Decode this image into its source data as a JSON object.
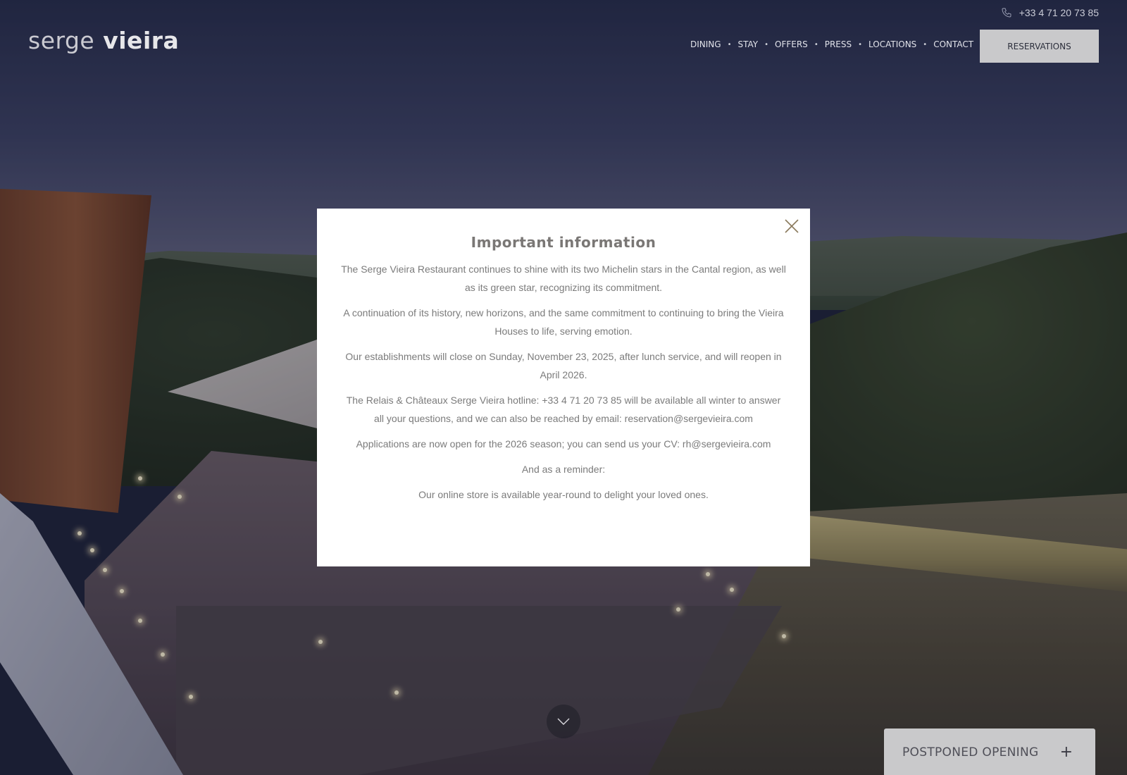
{
  "header": {
    "phone": "+33 4 71 20 73 85",
    "logo": {
      "light": "serge",
      "bold": "vieira"
    },
    "nav": [
      "DINING",
      "STAY",
      "OFFERS",
      "PRESS",
      "LOCATIONS",
      "CONTACT"
    ],
    "nav_separator": "•",
    "reservations_label": "RESERVATIONS"
  },
  "modal": {
    "title": "Important information",
    "paragraphs": [
      "The Serge Vieira Restaurant continues to shine with its two Michelin stars in the Cantal region, as well as its green star, recognizing its commitment.",
      "A continuation of its history, new horizons, and the same commitment to continuing to bring the Vieira Houses to life, serving emotion.",
      "Our establishments will close on Sunday, November 23, 2025, after lunch service, and will reopen in April 2026.",
      "The Relais & Châteaux Serge Vieira hotline: +33 4 71 20 73 85 will be available all winter to answer all your questions, and we can also be reached by email: reservation@sergevieira.com",
      "Applications are now open for the 2026 season; you can send us your CV: rh@sergevieira.com",
      "And as a reminder:",
      "Our online store is available year-round to delight your loved ones."
    ]
  },
  "postponed": {
    "label": "POSTPONED OPENING",
    "icon": "+"
  },
  "icons": {
    "phone": "phone-icon",
    "close": "close-icon",
    "scroll": "chevron-down-icon",
    "expand": "plus-icon"
  },
  "colors": {
    "reservations_bg": "#c9c9cb",
    "modal_bg": "#ffffff",
    "modal_text": "#7b7b7b",
    "close_icon": "#8a7a5c"
  }
}
